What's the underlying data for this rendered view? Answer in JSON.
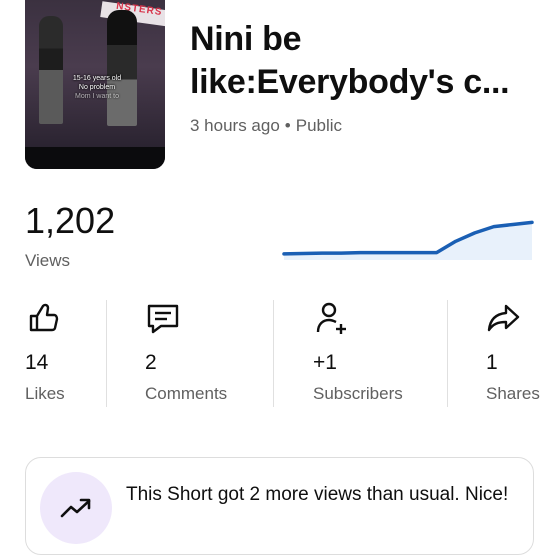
{
  "video": {
    "title_line1": "Nini be",
    "title_line2": "like:Everybody's c...",
    "time": "3 hours ago",
    "separator": "•",
    "visibility": "Public",
    "thumbnail": {
      "banner_text": "NSTERS",
      "caption_line1": "15-16 years old",
      "caption_line2": "No problem",
      "caption_line3": "Mom I want to"
    }
  },
  "views": {
    "count": "1,202",
    "label": "Views",
    "sparkline": [
      0.05,
      0.06,
      0.07,
      0.07,
      0.08,
      0.08,
      0.08,
      0.08,
      0.08,
      0.35,
      0.55,
      0.7,
      0.75,
      0.8
    ]
  },
  "stats": [
    {
      "icon": "thumb-up-icon",
      "value": "14",
      "label": "Likes"
    },
    {
      "icon": "comment-icon",
      "value": "2",
      "label": "Comments"
    },
    {
      "icon": "add-person-icon",
      "value": "+1",
      "label": "Subscribers"
    },
    {
      "icon": "share-icon",
      "value": "1",
      "label": "Shares"
    }
  ],
  "insight": {
    "icon": "trending-up-icon",
    "message": "This Short got 2 more views than usual. Nice!"
  },
  "colors": {
    "spark_line": "#1a5fb4",
    "spark_fill": "#e8f1fb",
    "insight_circle": "#efe8fb"
  }
}
